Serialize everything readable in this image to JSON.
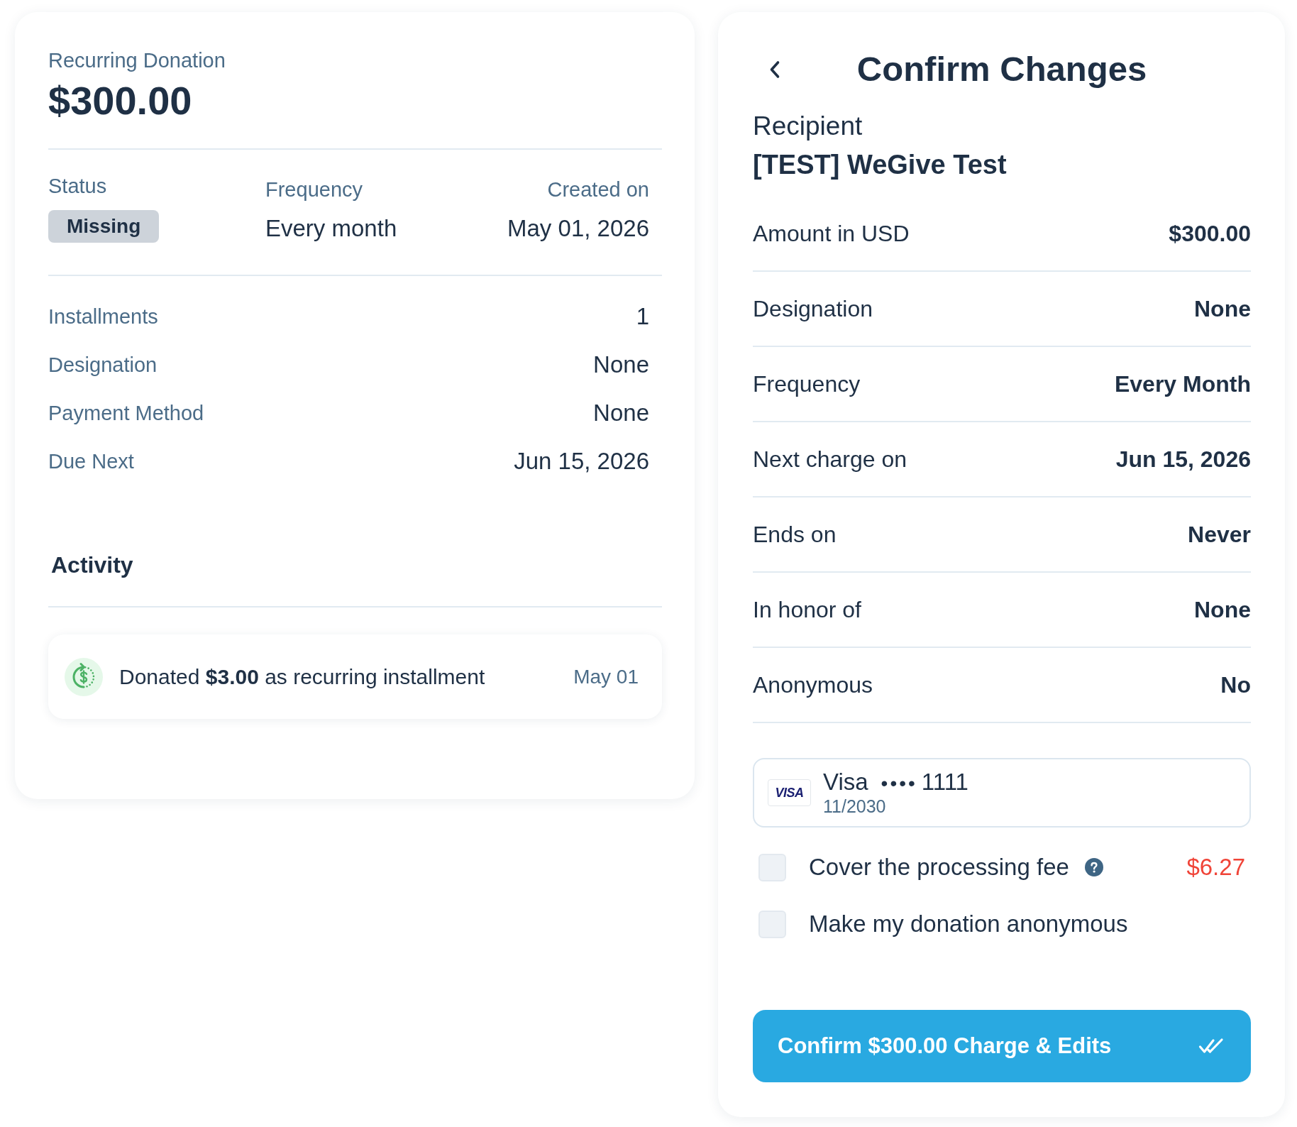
{
  "donation_summary": {
    "heading": "Recurring Donation",
    "amount": "$300.00",
    "overview": [
      {
        "kind": "badge",
        "label": "Status",
        "value": "Missing"
      },
      {
        "kind": "text",
        "label": "Frequency",
        "value": "Every month"
      },
      {
        "kind": "text",
        "label": "Created on",
        "value": "May 01, 2026"
      }
    ],
    "details": [
      {
        "label": "Installments",
        "value": "1"
      },
      {
        "label": "Designation",
        "value": "None"
      },
      {
        "label": "Payment Method",
        "value": "None"
      },
      {
        "label": "Due Next",
        "value": "Jun 15, 2026"
      }
    ],
    "activity": {
      "title": "Activity",
      "items": [
        {
          "text": "Donated **$3.00** as recurring installment",
          "date": "May 01"
        }
      ]
    }
  },
  "confirm_changes": {
    "title": "Confirm Changes",
    "recipient_label": "Recipient",
    "recipient": "[TEST] WeGive Test",
    "rows": [
      {
        "label": "Amount in USD",
        "value": "$300.00"
      },
      {
        "label": "Designation",
        "value": "None"
      },
      {
        "label": "Frequency",
        "value": "Every Month"
      },
      {
        "label": "Next charge on",
        "value": "Jun 15, 2026"
      },
      {
        "label": "Ends on",
        "value": "Never"
      },
      {
        "label": "In honor of",
        "value": "None"
      },
      {
        "label": "Anonymous",
        "value": "No"
      }
    ],
    "payment_card": {
      "logo": "VISA",
      "brand": "Visa",
      "masked": "••••",
      "last_digits": "1111",
      "expiry": "11/2030"
    },
    "options": [
      {
        "label": "Cover the processing fee",
        "checked": false,
        "help": true,
        "amount": "$6.27"
      },
      {
        "label": "Make my donation anonymous",
        "checked": false
      }
    ],
    "confirm_button": "Confirm $300.00 Charge & Edits"
  }
}
